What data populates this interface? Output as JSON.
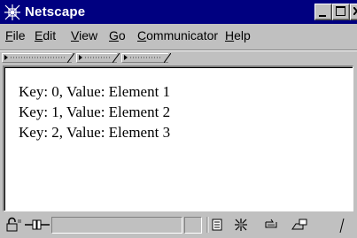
{
  "window": {
    "title": "Netscape"
  },
  "menubar": {
    "items": [
      {
        "key": "F",
        "rest": "ile"
      },
      {
        "key": "E",
        "rest": "dit"
      },
      {
        "key": "V",
        "rest": "iew"
      },
      {
        "key": "G",
        "rest": "o"
      },
      {
        "key": "C",
        "rest": "ommunicator"
      },
      {
        "key": "H",
        "rest": "elp"
      }
    ]
  },
  "content": {
    "lines": [
      "Key: 0, Value: Element 1",
      "Key: 1, Value: Element 2",
      "Key: 2, Value: Element 3"
    ]
  },
  "colors": {
    "titlebar": "#000080",
    "chrome": "#c0c0c0",
    "page_background": "#ffffff"
  },
  "icons": {
    "app": "netscape-logo-icon",
    "status": [
      "security-lock-icon",
      "connection-status-icon",
      "component-bar-icons"
    ]
  }
}
